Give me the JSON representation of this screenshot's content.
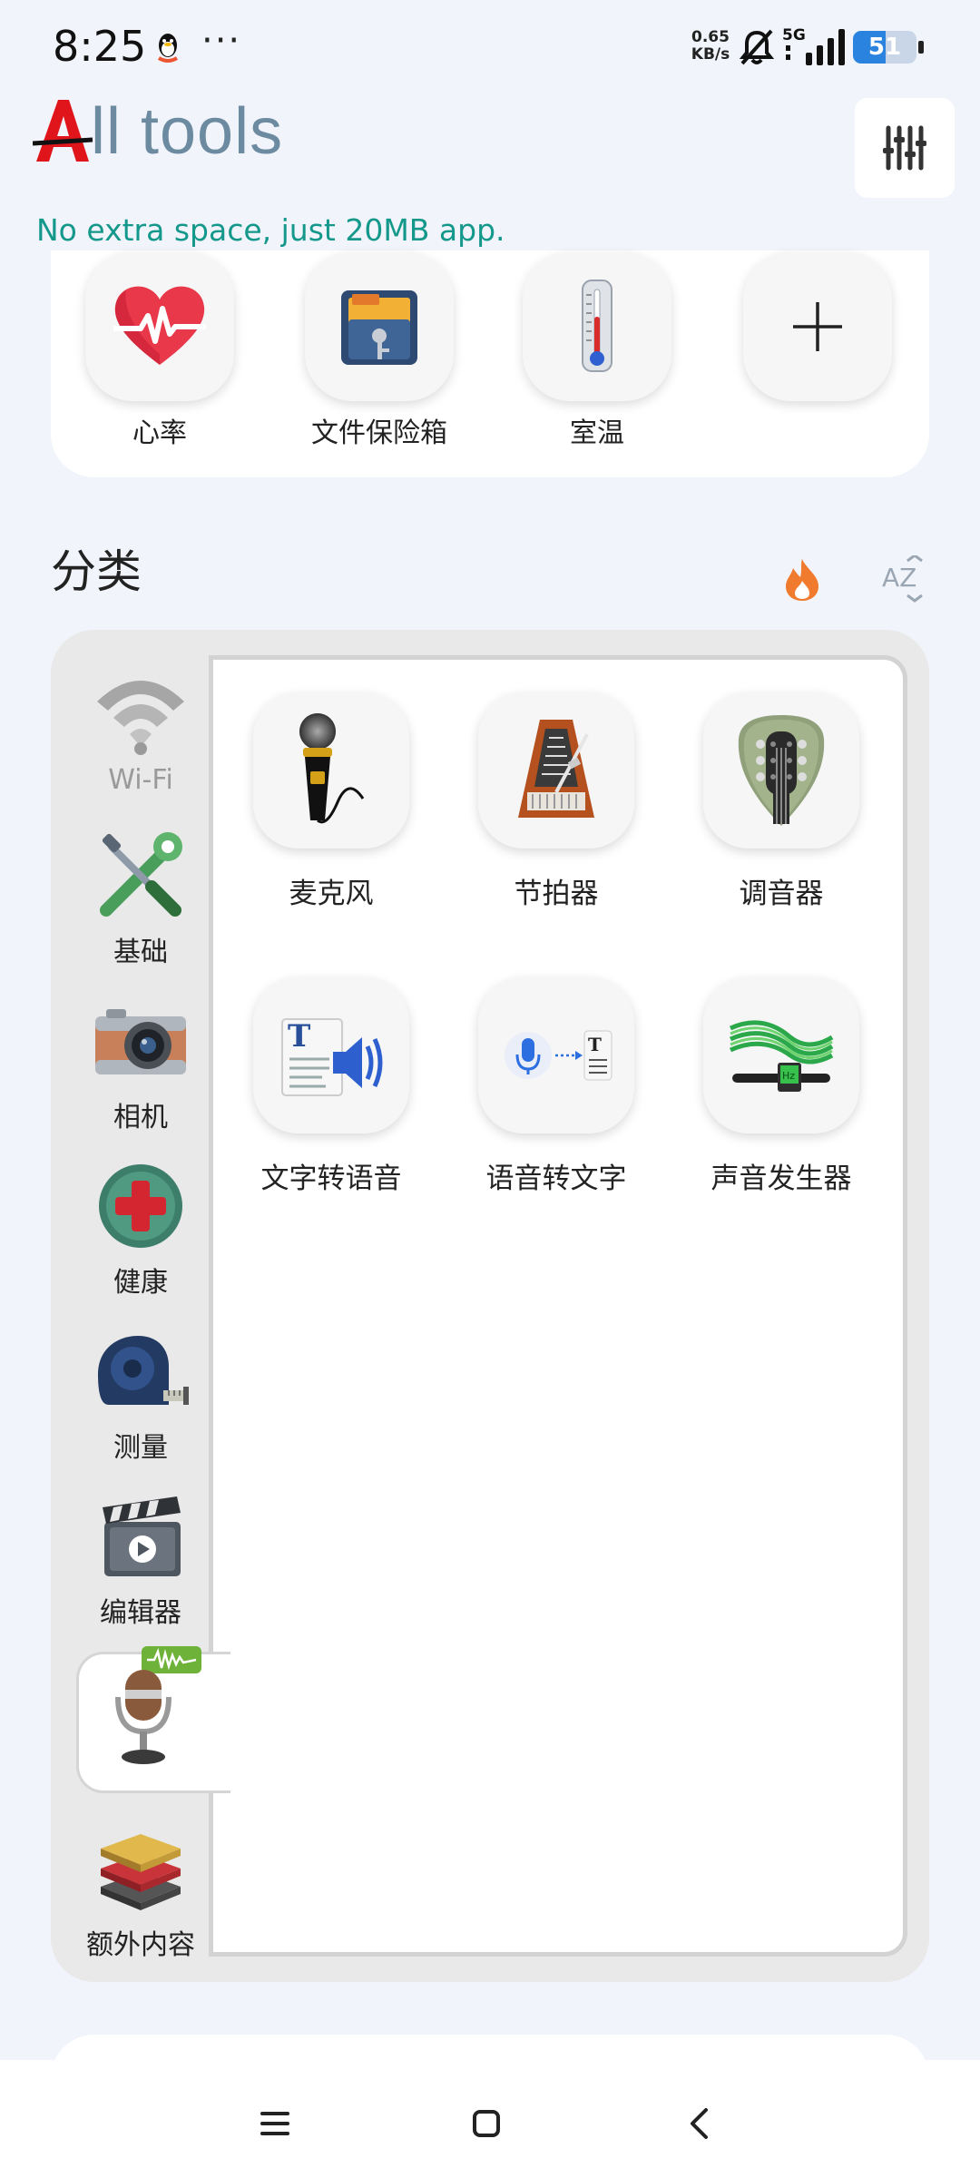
{
  "status_bar": {
    "time": "8:25",
    "more": "···",
    "net_speed_value": "0.65",
    "net_speed_unit": "KB/s",
    "network": "5G",
    "battery_level": "51",
    "battery_fraction": 0.51
  },
  "header": {
    "logo_letter": "A",
    "title": "ll tools",
    "tagline": "No extra space, just 20MB app."
  },
  "favorites": [
    {
      "label": "心率",
      "icon": "heart-rate-icon"
    },
    {
      "label": "文件保险箱",
      "icon": "file-vault-icon"
    },
    {
      "label": "室温",
      "icon": "thermometer-icon"
    },
    {
      "label": "",
      "icon": "plus-icon"
    }
  ],
  "categories_section": {
    "title": "分类",
    "sort_hot_icon": "fire-icon",
    "sort_az_label": "AZ"
  },
  "categories": [
    {
      "label": "Wi-Fi",
      "icon": "wifi-icon",
      "muted": true
    },
    {
      "label": "基础",
      "icon": "tools-icon"
    },
    {
      "label": "相机",
      "icon": "camera-icon"
    },
    {
      "label": "健康",
      "icon": "health-icon"
    },
    {
      "label": "测量",
      "icon": "tape-measure-icon"
    },
    {
      "label": "编辑器",
      "icon": "clapperboard-icon"
    },
    {
      "label": "",
      "icon": "audio-microphone-icon",
      "selected": true
    },
    {
      "label": "额外内容",
      "icon": "extras-stack-icon"
    }
  ],
  "tools": [
    {
      "label": "麦克风",
      "icon": "microphone-icon"
    },
    {
      "label": "节拍器",
      "icon": "metronome-icon"
    },
    {
      "label": "调音器",
      "icon": "guitar-tuner-icon"
    },
    {
      "label": "文字转语音",
      "icon": "text-to-speech-icon"
    },
    {
      "label": "语音转文字",
      "icon": "speech-to-text-icon"
    },
    {
      "label": "声音发生器",
      "icon": "sound-generator-icon"
    }
  ],
  "colors": {
    "accent_teal": "#14988b",
    "title_slate": "#6c8aa0",
    "logo_red": "#e0151b",
    "background": "#f1f4fa"
  },
  "nav": {
    "menu_icon": "menu-icon",
    "home_icon": "home-icon",
    "back_icon": "back-icon"
  }
}
